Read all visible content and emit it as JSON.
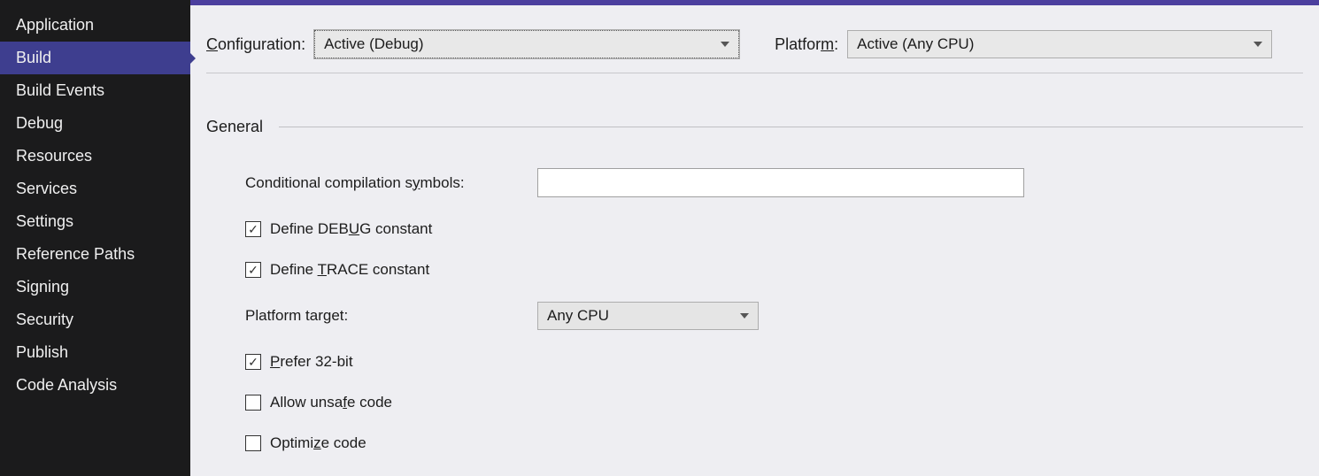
{
  "sidebar": {
    "items": [
      {
        "label": "Application"
      },
      {
        "label": "Build"
      },
      {
        "label": "Build Events"
      },
      {
        "label": "Debug"
      },
      {
        "label": "Resources"
      },
      {
        "label": "Services"
      },
      {
        "label": "Settings"
      },
      {
        "label": "Reference Paths"
      },
      {
        "label": "Signing"
      },
      {
        "label": "Security"
      },
      {
        "label": "Publish"
      },
      {
        "label": "Code Analysis"
      }
    ],
    "activeIndex": 1
  },
  "header": {
    "config_label_prefix": "C",
    "config_label_rest": "onfiguration:",
    "platform_label_prefix": "Platfor",
    "platform_label_u": "m",
    "platform_label_suffix": ":",
    "configuration_value": "Active (Debug)",
    "platform_value": "Active (Any CPU)"
  },
  "section": {
    "title": "General",
    "symbols_label": "Conditional compilation s",
    "symbols_label_u": "y",
    "symbols_label_end": "mbols:",
    "symbols_value": "",
    "debug_pre": "Define DEB",
    "debug_u": "U",
    "debug_post": "G constant",
    "debug_checked": true,
    "trace_pre": "Define ",
    "trace_u": "T",
    "trace_post": "RACE constant",
    "trace_checked": true,
    "platform_target_pre": "Platform tar",
    "platform_target_u": "g",
    "platform_target_post": "et:",
    "platform_target_value": "Any CPU",
    "prefer32_u": "P",
    "prefer32_post": "refer 32-bit",
    "prefer32_checked": true,
    "unsafe_pre": "Allow unsa",
    "unsafe_u": "f",
    "unsafe_post": "e code",
    "unsafe_checked": false,
    "optimize_pre": "Optimi",
    "optimize_u": "z",
    "optimize_post": "e code",
    "optimize_checked": false
  }
}
